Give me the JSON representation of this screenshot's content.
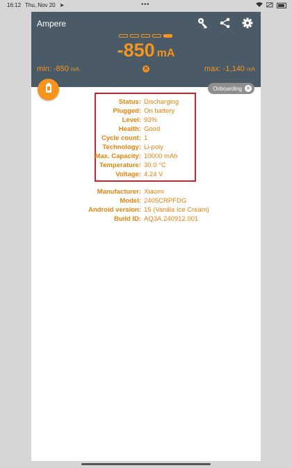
{
  "status_bar": {
    "time": "16:12",
    "date": "Thu, Nov 20",
    "center": "•••"
  },
  "app": {
    "title": "Ampere",
    "current_value": "-850",
    "current_unit": "mA",
    "min_label": "min: -850",
    "min_unit": "mA",
    "max_label": "max: -1,140",
    "max_unit": "mA",
    "level_segments_filled": 1,
    "level_segments_total": 5,
    "onboarding_chip": "Onboarding",
    "accent_color": "#f7941d",
    "header_color": "#4a5a66"
  },
  "battery_info": [
    {
      "label": "Status:",
      "value": "Discharging"
    },
    {
      "label": "Plugged:",
      "value": "On battery"
    },
    {
      "label": "Level:",
      "value": "93%"
    },
    {
      "label": "Health:",
      "value": "Good"
    },
    {
      "label": "Cycle count:",
      "value": "1"
    },
    {
      "label": "Technology:",
      "value": "Li-poly"
    },
    {
      "label": "Max. Capacity:",
      "value": "10000 mAh"
    },
    {
      "label": "Temperature:",
      "value": "30.0 °C"
    },
    {
      "label": "Voltage:",
      "value": "4.24 V"
    }
  ],
  "device_info": [
    {
      "label": "Manufacturer:",
      "value": "Xiaomi"
    },
    {
      "label": "Model:",
      "value": "2405CRPFDG"
    },
    {
      "label": "Android version:",
      "value": "15 (Vanilla Ice Cream)"
    },
    {
      "label": "Build ID:",
      "value": "AQ3A.240912.001"
    }
  ],
  "icons": [
    "key-icon",
    "share-icon",
    "settings-icon",
    "battery-icon",
    "close-icon"
  ]
}
